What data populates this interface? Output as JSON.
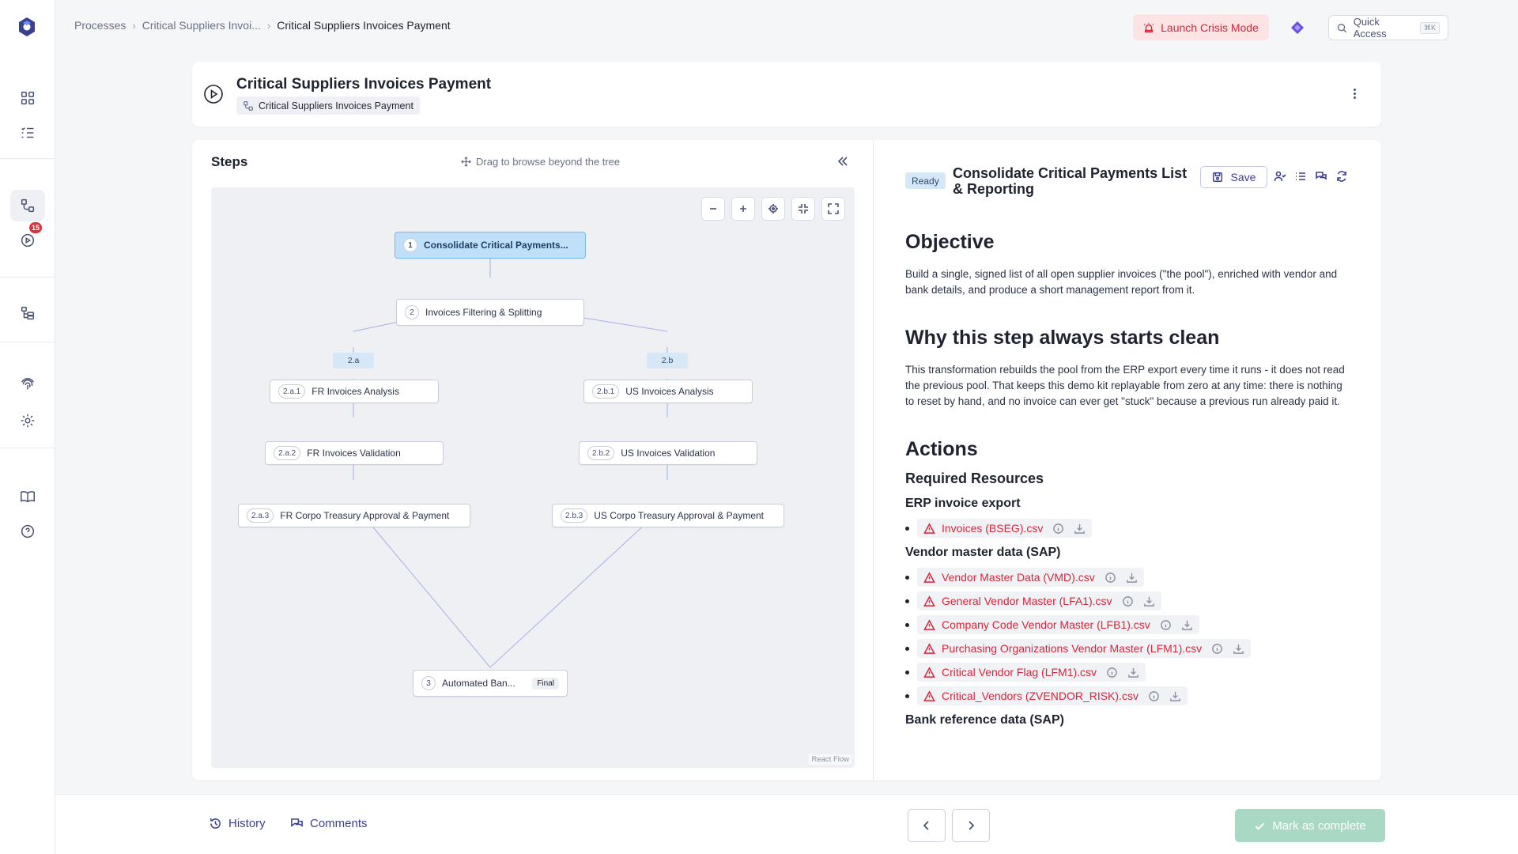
{
  "breadcrumb": {
    "items": [
      "Processes",
      "Critical Suppliers Invoi...",
      "Critical Suppliers Invoices Payment"
    ]
  },
  "topbar": {
    "crisis_label": "Launch Crisis Mode",
    "quick_access_label": "Quick Access",
    "quick_access_shortcut": "⌘K"
  },
  "sidebar": {
    "runs_badge": "15"
  },
  "process": {
    "title": "Critical Suppliers Invoices Payment",
    "chip_label": "Critical Suppliers Invoices Payment"
  },
  "steps_panel": {
    "title": "Steps",
    "drag_hint": "Drag to browse beyond the tree",
    "attribution": "React Flow",
    "branch_labels": [
      "2.a",
      "2.b"
    ],
    "nodes": [
      {
        "num": "1",
        "label": "Consolidate Critical Payments...",
        "selected": true
      },
      {
        "num": "2",
        "label": "Invoices Filtering & Splitting"
      },
      {
        "num": "2.a.1",
        "label": "FR Invoices Analysis"
      },
      {
        "num": "2.b.1",
        "label": "US Invoices Analysis"
      },
      {
        "num": "2.a.2",
        "label": "FR Invoices Validation"
      },
      {
        "num": "2.b.2",
        "label": "US Invoices Validation"
      },
      {
        "num": "2.a.3",
        "label": "FR Corpo Treasury Approval & Payment"
      },
      {
        "num": "2.b.3",
        "label": "US Corpo Treasury Approval & Payment"
      },
      {
        "num": "3",
        "label": "Automated Ban...",
        "tag": "Final"
      }
    ]
  },
  "step_detail": {
    "status": "Ready",
    "title": "Consolidate Critical Payments List & Reporting",
    "save_label": "Save",
    "objective_heading": "Objective",
    "objective_text": "Build a single, signed list of all open supplier invoices (\"the pool\"), enriched with vendor and bank details, and produce a short management report from it.",
    "why_heading": "Why this step always starts clean",
    "why_text": "This transformation rebuilds the pool from the ERP export every time it runs - it does not read the previous pool. That keeps this demo kit replayable from zero at any time: there is nothing to reset by hand, and no invoice can ever get \"stuck\" because a previous run already paid it.",
    "actions_heading": "Actions",
    "required_heading": "Required Resources",
    "groups": [
      {
        "title": "ERP invoice export",
        "files": [
          "Invoices (BSEG).csv"
        ]
      },
      {
        "title": "Vendor master data (SAP)",
        "files": [
          "Vendor Master Data (VMD).csv",
          "General Vendor Master (LFA1).csv",
          "Company Code Vendor Master (LFB1).csv",
          "Purchasing Organizations Vendor Master (LFM1).csv",
          "Critical Vendor Flag (LFM1).csv",
          "Critical_Vendors (ZVENDOR_RISK).csv"
        ]
      },
      {
        "title": "Bank reference data (SAP)",
        "files": []
      }
    ]
  },
  "bottombar": {
    "history_label": "History",
    "comments_label": "Comments",
    "complete_label": "Mark as complete"
  },
  "colors": {
    "accent": "#3a3f8f",
    "danger": "#d6263a",
    "selected_node": "#bfe0f8",
    "complete_disabled": "#a9d9c5"
  }
}
